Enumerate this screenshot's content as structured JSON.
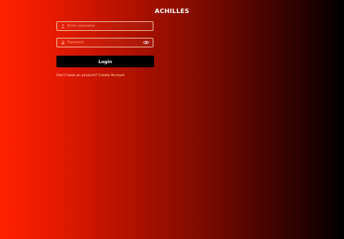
{
  "app": {
    "title": "ACHILLES"
  },
  "form": {
    "username": {
      "placeholder": "Enter username",
      "value": "",
      "icon": "user-icon"
    },
    "password": {
      "placeholder": "Password",
      "value": "",
      "icon": "lock-icon",
      "toggle_icon": "eye-icon"
    },
    "login_label": "Login",
    "signup_prompt": "Don't have an account?",
    "signup_link": "Create Account"
  },
  "colors": {
    "background_start": "#ff2200",
    "background_end": "#000000",
    "button": "#000000",
    "link": "#ffe08a"
  }
}
